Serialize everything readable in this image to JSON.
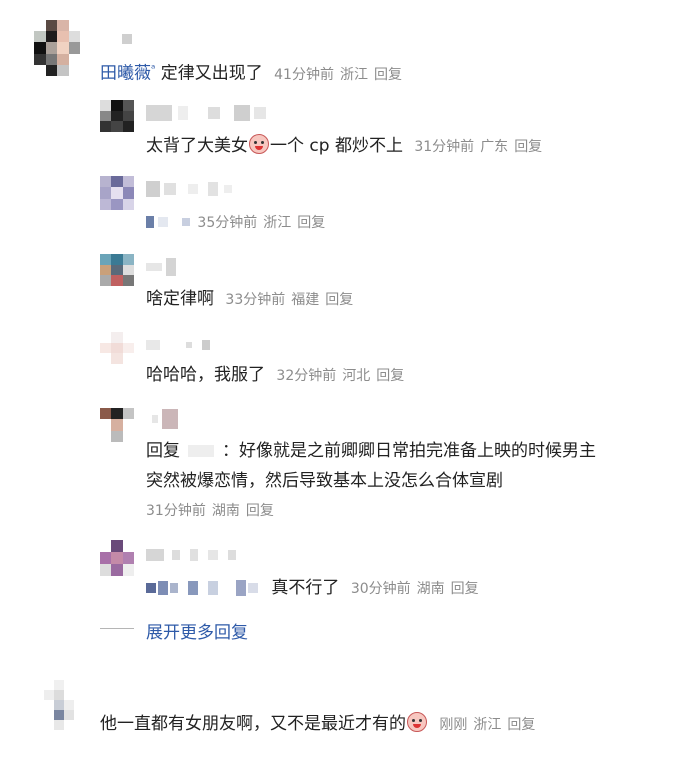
{
  "top_comment": {
    "username": "田曦薇",
    "badge": "ᵃ",
    "text": "定律又出现了",
    "time": "41分钟前",
    "location": "浙江",
    "reply": "回复"
  },
  "replies": [
    {
      "text_before": "太背了大美女",
      "text_after": "一个 cp 都炒不上",
      "time": "31分钟前",
      "location": "广东",
      "reply": "回复"
    },
    {
      "time": "35分钟前",
      "location": "浙江",
      "reply": "回复"
    },
    {
      "text": "啥定律啊",
      "time": "33分钟前",
      "location": "福建",
      "reply": "回复"
    },
    {
      "text": "哈哈哈，我服了",
      "time": "32分钟前",
      "location": "河北",
      "reply": "回复"
    },
    {
      "reply_prefix": "回复",
      "line1": "：好像就是之前卿卿日常拍完准备上映的时候男主",
      "line2": "突然被爆恋情，然后导致基本上没怎么合体宣剧",
      "time": "31分钟前",
      "location": "湖南",
      "reply": "回复"
    },
    {
      "text": "真不行了",
      "time": "30分钟前",
      "location": "湖南",
      "reply": "回复"
    }
  ],
  "expand_more": "展开更多回复",
  "bottom_comment": {
    "text": "他一直都有女朋友啊，又不是最近才有的",
    "time": "刚刚",
    "location": "浙江",
    "reply": "回复"
  },
  "colors": {
    "link": "#2e5aa8",
    "meta": "#8c8c8c",
    "text": "#222222"
  },
  "icons": [
    "crying-emoji-icon",
    "laughing-crying-emoji-icon"
  ]
}
